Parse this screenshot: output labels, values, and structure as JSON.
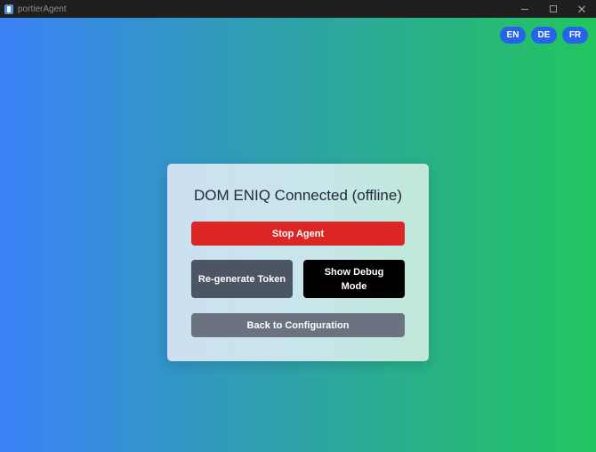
{
  "window": {
    "title": "portierAgent"
  },
  "languages": [
    "EN",
    "DE",
    "FR"
  ],
  "card": {
    "title": "DOM ENIQ Connected (offline)",
    "stop_label": "Stop Agent",
    "regenerate_label": "Re-generate Token",
    "debug_label": "Show Debug Mode",
    "back_label": "Back to Configuration"
  },
  "colors": {
    "gradient_start": "#3a82f6",
    "gradient_end": "#22c55e",
    "stop": "#dc2626",
    "regenerate": "#4b5563",
    "debug": "#000000",
    "back": "#6b7280",
    "language": "#2563eb"
  },
  "icons": {
    "app": "portier-app-icon",
    "minimize": "minimize-icon",
    "maximize": "maximize-icon",
    "close": "close-icon"
  }
}
